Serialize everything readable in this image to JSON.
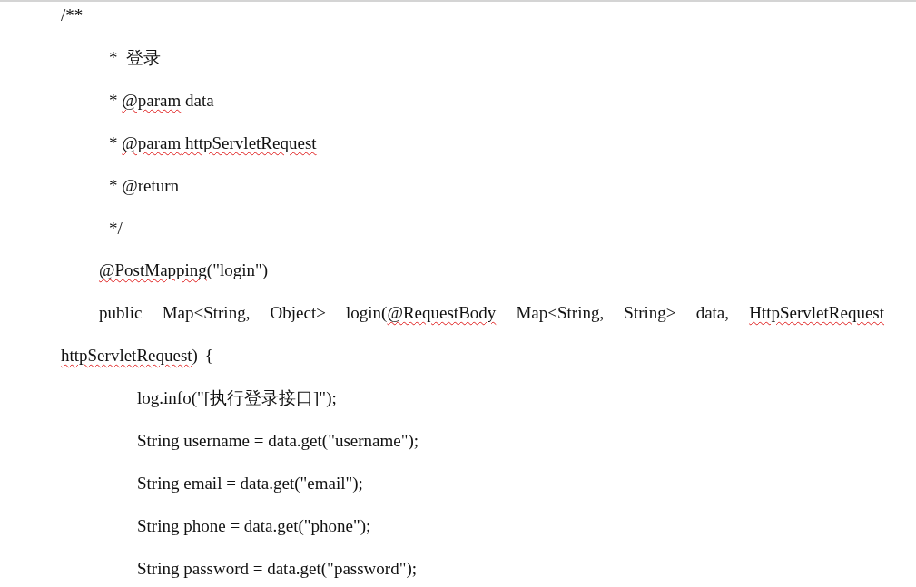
{
  "document": {
    "lines": [
      {
        "kind": "margin",
        "segments": [
          {
            "text": "/**",
            "flagged": false
          }
        ]
      },
      {
        "kind": "comment",
        "segments": [
          {
            "text": "*  登录",
            "flagged": false
          }
        ]
      },
      {
        "kind": "comment",
        "segments": [
          {
            "text": "* ",
            "flagged": false
          },
          {
            "text": "@param",
            "flagged": true
          },
          {
            "text": " data",
            "flagged": false
          }
        ]
      },
      {
        "kind": "comment",
        "segments": [
          {
            "text": "* ",
            "flagged": false
          },
          {
            "text": "@param",
            "flagged": true
          },
          {
            "text": " httpServletRequest",
            "flagged": true
          }
        ]
      },
      {
        "kind": "comment",
        "segments": [
          {
            "text": "* @return",
            "flagged": false
          }
        ]
      },
      {
        "kind": "comment",
        "segments": [
          {
            "text": "*/",
            "flagged": false
          }
        ]
      },
      {
        "kind": "method",
        "segments": [
          {
            "text": "@PostMapping",
            "flagged": true
          },
          {
            "text": "(\"login\")",
            "flagged": false
          }
        ]
      },
      {
        "kind": "wrapped",
        "segments": [
          {
            "text": "public Map<String, Object> login(",
            "flagged": false
          },
          {
            "text": "@RequestBody",
            "flagged": true
          },
          {
            "text": " Map<String, String> data, ",
            "flagged": false
          },
          {
            "text": "HttpServletRequest",
            "flagged": true
          },
          {
            "text": " httpServletRequest",
            "flagged": true
          },
          {
            "text": ") {",
            "flagged": false
          }
        ]
      },
      {
        "kind": "body",
        "segments": [
          {
            "text": "log.info(\"[执行登录接口]\");",
            "flagged": false
          }
        ]
      },
      {
        "kind": "body",
        "segments": [
          {
            "text": "String username = data.get(\"username\");",
            "flagged": false
          }
        ]
      },
      {
        "kind": "body",
        "segments": [
          {
            "text": "String email = data.get(\"email\");",
            "flagged": false
          }
        ]
      },
      {
        "kind": "body",
        "segments": [
          {
            "text": "String phone = data.get(\"phone\");",
            "flagged": false
          }
        ]
      },
      {
        "kind": "body",
        "segments": [
          {
            "text": "String password = data.get(\"password\");",
            "flagged": false
          }
        ]
      }
    ]
  }
}
